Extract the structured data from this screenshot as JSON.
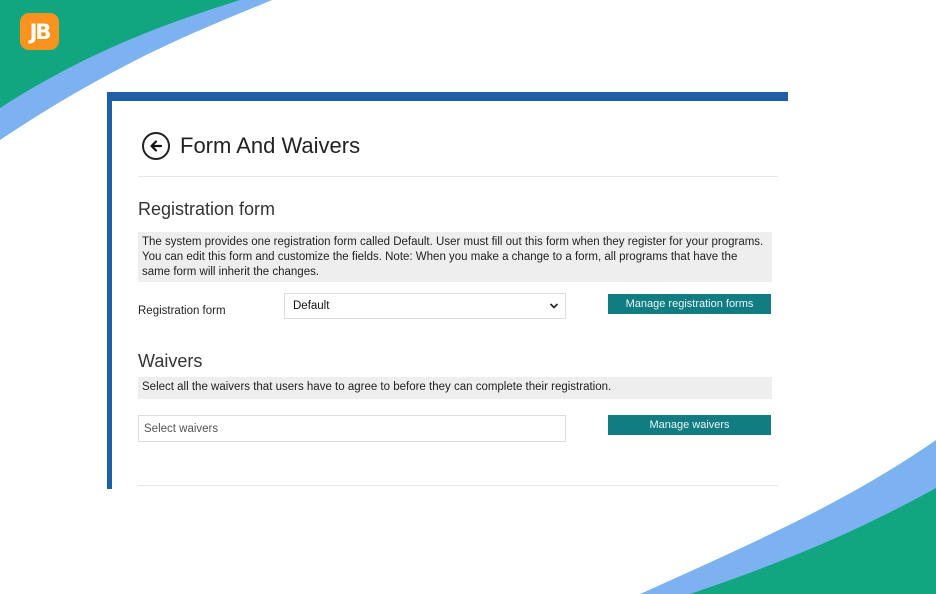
{
  "brand": {
    "logo_text": "JB",
    "accent": "#f7931e",
    "wave_green": "#12a680",
    "wave_blue": "#7bb2ef"
  },
  "page": {
    "title": "Form And Waivers",
    "back_icon": "arrow-left-circle-icon"
  },
  "registration": {
    "section_title": "Registration form",
    "description": "The system provides one registration form called Default. User must fill out this form when they register for your programs. You can edit this form and customize the fields. Note: When you make a change to a form, all programs that have the same form will inherit the changes.",
    "field_label": "Registration form",
    "selected_value": "Default",
    "manage_label": "Manage registration forms"
  },
  "waivers": {
    "section_title": "Waivers",
    "description": "Select all the waivers that users have to agree to before they can complete their registration.",
    "placeholder": "Select waivers",
    "manage_label": "Manage waivers"
  },
  "colors": {
    "window_border": "#1f5fa8",
    "button": "#127c83"
  }
}
